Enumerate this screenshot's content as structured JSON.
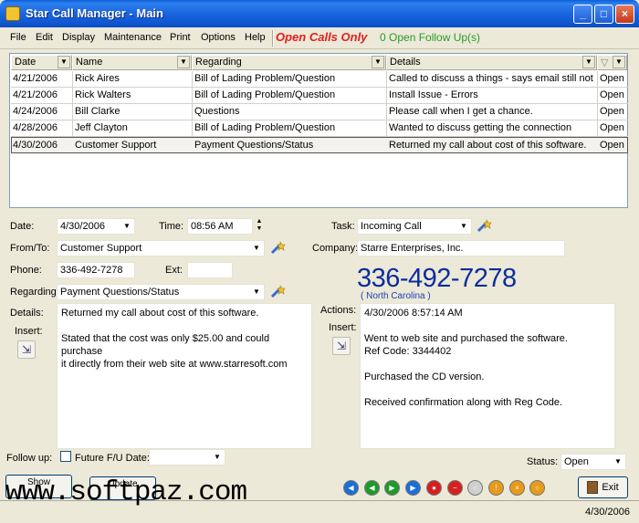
{
  "window": {
    "title": "Star Call Manager - Main",
    "minimize": "_",
    "maximize": "□",
    "close": "×"
  },
  "menu": {
    "items": [
      "File",
      "Edit",
      "Display",
      "Maintenance",
      "Print",
      "Options",
      "Help"
    ],
    "open_calls_only": "Open Calls Only",
    "open_follow_ups": "0  Open Follow Up(s)"
  },
  "grid": {
    "columns": [
      "Date",
      "Name",
      "Regarding",
      "Details",
      "▽"
    ],
    "rows": [
      [
        "4/21/2006",
        "Rick Aires",
        "Bill of Lading Problem/Question",
        "Called to discuss a things - says email still not",
        "Open"
      ],
      [
        "4/21/2006",
        "Rick Walters",
        "Bill of Lading Problem/Question",
        "Install Issue - Errors",
        "Open"
      ],
      [
        "4/24/2006",
        "Bill Clarke",
        "Questions",
        "Please call when I get a chance.",
        "Open"
      ],
      [
        "4/28/2006",
        "Jeff Clayton",
        "Bill of Lading Problem/Question",
        "Wanted to discuss getting the connection",
        "Open"
      ],
      [
        "4/30/2006",
        "Customer Support",
        "Payment Questions/Status",
        "Returned my call about cost of this software.",
        "Open"
      ]
    ],
    "selected_row": 4
  },
  "form": {
    "date_label": "Date:",
    "date_value": "4/30/2006",
    "time_label": "Time:",
    "time_value": "08:56 AM",
    "task_label": "Task:",
    "task_value": "Incoming Call",
    "fromto_label": "From/To:",
    "fromto_value": "Customer Support",
    "company_label": "Company:",
    "company_value": "Starre Enterprises, Inc.",
    "phone_label": "Phone:",
    "phone_value": "336-492-7278",
    "ext_label": "Ext:",
    "ext_value": "",
    "big_phone": "336-492-7278",
    "region": "( North Carolina )",
    "regarding_label": "Regarding:",
    "regarding_value": "Payment Questions/Status",
    "details_label": "Details:",
    "details_insert_label": "Insert:",
    "details_text": "Returned my call about cost of this software.\n\nStated that the cost was only $25.00 and could purchase\nit directly from their web site at www.starresoft.com",
    "actions_label": "Actions:",
    "actions_insert_label": "Insert:",
    "actions_text": "4/30/2006 8:57:14 AM\n\nWent to web site and purchased the software.\nRef Code: 3344402\n\nPurchased the CD version.\n\nReceived confirmation along with Reg Code.",
    "followup_label": "Follow up:",
    "future_fu_label": "Future F/U Date:",
    "future_fu_value": "",
    "status_label": "Status:",
    "status_value": "Open"
  },
  "buttons": {
    "show_label": "Show",
    "update_label": "Update",
    "exit_label": "Exit"
  },
  "statusbar": {
    "date": "4/30/2006"
  },
  "watermark": "www.softpaz.com",
  "colors": {
    "title_blue": "#0a5fd8",
    "open_calls_red": "#e0201c",
    "follow_green": "#2a9a2a",
    "phone_blue": "#0c2d9c"
  },
  "nav_buttons": [
    {
      "icon": "first-icon",
      "color": "#1a6fd6"
    },
    {
      "icon": "prev-icon",
      "color": "#1f9a2a"
    },
    {
      "icon": "next-icon",
      "color": "#1f9a2a"
    },
    {
      "icon": "last-icon",
      "color": "#1a6fd6"
    },
    {
      "icon": "delete-icon",
      "color": "#d62020"
    },
    {
      "icon": "cancel-icon",
      "color": "#d62020"
    },
    {
      "icon": "blank-icon",
      "color": "#cfcfcf"
    },
    {
      "icon": "warning-icon",
      "color": "#e89a1a"
    },
    {
      "icon": "stop-icon",
      "color": "#e89a1a"
    },
    {
      "icon": "alert-icon",
      "color": "#e89a1a"
    }
  ]
}
